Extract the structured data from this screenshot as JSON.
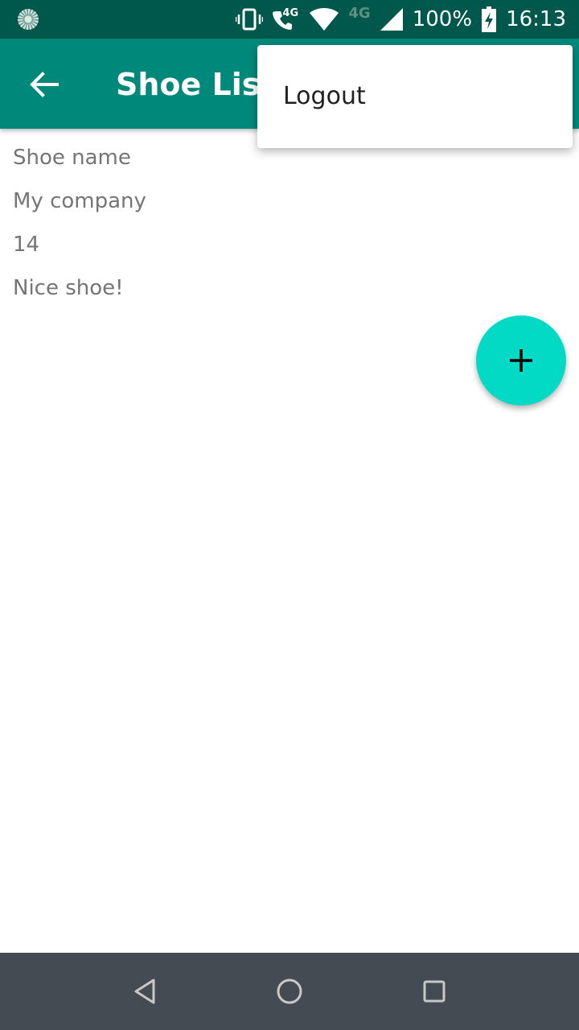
{
  "status_bar": {
    "network_a": "4G",
    "network_b": "4G",
    "battery": "100%",
    "time": "16:13"
  },
  "toolbar": {
    "title": "Shoe List"
  },
  "shoe": {
    "name": "Shoe name",
    "company": "My company",
    "size": "14",
    "description": "Nice shoe!"
  },
  "menu": {
    "items": [
      {
        "label": "Logout"
      }
    ]
  },
  "colors": {
    "status_bar": "#00584c",
    "toolbar": "#00897b",
    "fab": "#03dac6",
    "nav_bar": "#454b52"
  },
  "icons": {
    "back": "arrow-back-icon",
    "fab": "plus-icon",
    "nav": [
      "back-triangle-icon",
      "home-circle-icon",
      "recents-square-icon"
    ]
  }
}
